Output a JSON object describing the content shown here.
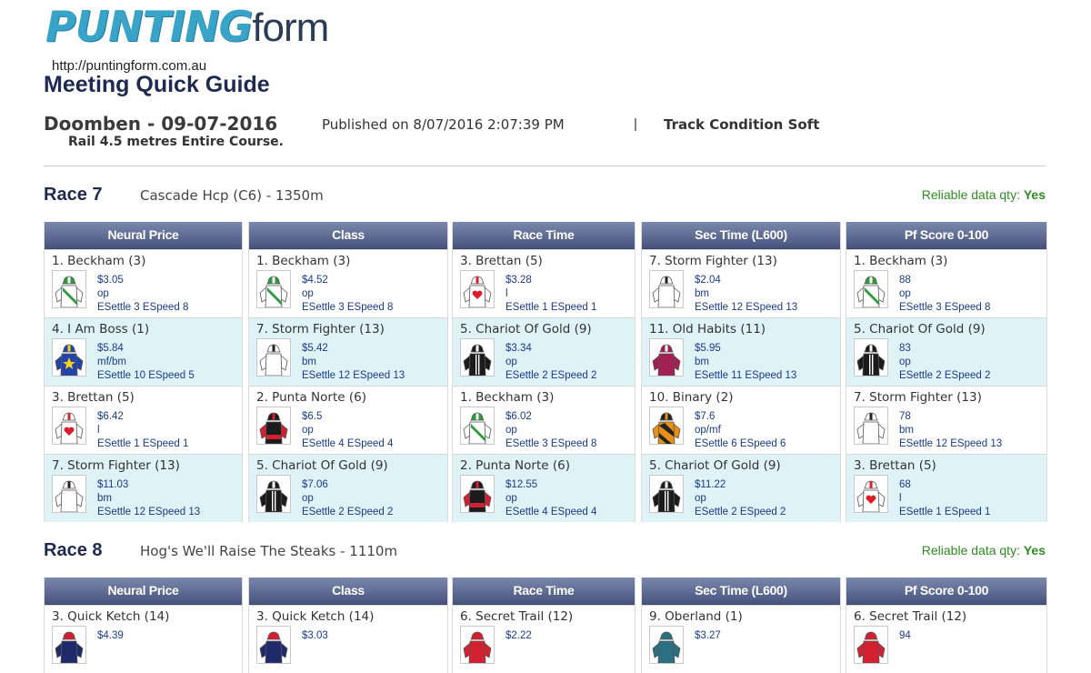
{
  "brand": {
    "logo_bold": "PUNTING",
    "logo_light": "form",
    "url": "http://puntingform.com.au"
  },
  "page": {
    "title": "Meeting Quick Guide",
    "meeting": "Doomben - 09-07-2016",
    "published": "Published on 8/07/2016 2:07:39 PM",
    "separator": "|",
    "track": "Track Condition Soft",
    "rail": "Rail 4.5 metres Entire Course."
  },
  "columns": [
    "Neural Price",
    "Class",
    "Race Time",
    "Sec Time (L600)",
    "Pf Score 0-100"
  ],
  "races": [
    {
      "label": "Race 7",
      "name": "Cascade Hcp (C6) - 1350m",
      "reliable_label": "Reliable data qty:",
      "reliable_value": "Yes",
      "columns": [
        [
          {
            "name": "1. Beckham (3)",
            "silk": "green-white",
            "value": "$3.05",
            "line2": "op",
            "line3": "ESettle 3 ESpeed 8"
          },
          {
            "name": "4. I Am Boss (1)",
            "silk": "blue-yellow",
            "value": "$5.84",
            "line2": "mf/bm",
            "line3": "ESettle 10 ESpeed 5"
          },
          {
            "name": "3. Brettan (5)",
            "silk": "white-red-heart",
            "value": "$6.42",
            "line2": "l",
            "line3": "ESettle 1 ESpeed 1"
          },
          {
            "name": "7. Storm Fighter (13)",
            "silk": "white-black-moon",
            "value": "$11.03",
            "line2": "bm",
            "line3": "ESettle 12 ESpeed 13"
          }
        ],
        [
          {
            "name": "1. Beckham (3)",
            "silk": "green-white",
            "value": "$4.52",
            "line2": "op",
            "line3": "ESettle 3 ESpeed 8"
          },
          {
            "name": "7. Storm Fighter (13)",
            "silk": "white-black-moon",
            "value": "$5.42",
            "line2": "bm",
            "line3": "ESettle 12 ESpeed 13"
          },
          {
            "name": "2. Punta Norte (6)",
            "silk": "black-red",
            "value": "$6.5",
            "line2": "op",
            "line3": "ESettle 4 ESpeed 4"
          },
          {
            "name": "5. Chariot Of Gold (9)",
            "silk": "black-white",
            "value": "$7.06",
            "line2": "op",
            "line3": "ESettle 2 ESpeed 2"
          }
        ],
        [
          {
            "name": "3. Brettan (5)",
            "silk": "white-red-heart",
            "value": "$3.28",
            "line2": "l",
            "line3": "ESettle 1 ESpeed 1"
          },
          {
            "name": "5. Chariot Of Gold (9)",
            "silk": "black-white",
            "value": "$3.34",
            "line2": "op",
            "line3": "ESettle 2 ESpeed 2"
          },
          {
            "name": "1. Beckham (3)",
            "silk": "green-white",
            "value": "$6.02",
            "line2": "op",
            "line3": "ESettle 3 ESpeed 8"
          },
          {
            "name": "2. Punta Norte (6)",
            "silk": "black-red",
            "value": "$12.55",
            "line2": "op",
            "line3": "ESettle 4 ESpeed 4"
          }
        ],
        [
          {
            "name": "7. Storm Fighter (13)",
            "silk": "white-black-moon",
            "value": "$2.04",
            "line2": "bm",
            "line3": "ESettle 12 ESpeed 13"
          },
          {
            "name": "11. Old Habits (11)",
            "silk": "maroon",
            "value": "$5.95",
            "line2": "bm",
            "line3": "ESettle 11 ESpeed 13"
          },
          {
            "name": "10. Binary (2)",
            "silk": "black-orange",
            "value": "$7.6",
            "line2": "op/mf",
            "line3": "ESettle 6 ESpeed 6"
          },
          {
            "name": "5. Chariot Of Gold (9)",
            "silk": "black-white",
            "value": "$11.22",
            "line2": "op",
            "line3": "ESettle 2 ESpeed 2"
          }
        ],
        [
          {
            "name": "1. Beckham (3)",
            "silk": "green-white",
            "value": "88",
            "line2": "op",
            "line3": "ESettle 3 ESpeed 8"
          },
          {
            "name": "5. Chariot Of Gold (9)",
            "silk": "black-white",
            "value": "83",
            "line2": "op",
            "line3": "ESettle 2 ESpeed 2"
          },
          {
            "name": "7. Storm Fighter (13)",
            "silk": "white-black-moon",
            "value": "78",
            "line2": "bm",
            "line3": "ESettle 12 ESpeed 13"
          },
          {
            "name": "3. Brettan (5)",
            "silk": "white-red-heart",
            "value": "68",
            "line2": "l",
            "line3": "ESettle 1 ESpeed 1"
          }
        ]
      ]
    },
    {
      "label": "Race 8",
      "name": "Hog's We'll Raise The Steaks - 1110m",
      "reliable_label": "Reliable data qty:",
      "reliable_value": "Yes",
      "columns": [
        [
          {
            "name": "3. Quick Ketch (14)",
            "silk": "navy-red",
            "value": "$4.39"
          }
        ],
        [
          {
            "name": "3. Quick Ketch (14)",
            "silk": "navy-red",
            "value": "$3.03"
          }
        ],
        [
          {
            "name": "6. Secret Trail (12)",
            "silk": "red",
            "value": "$2.22"
          }
        ],
        [
          {
            "name": "9. Oberland (1)",
            "silk": "teal",
            "value": "$3.27"
          }
        ],
        [
          {
            "name": "6. Secret Trail (12)",
            "silk": "red",
            "value": "94"
          }
        ]
      ]
    }
  ]
}
